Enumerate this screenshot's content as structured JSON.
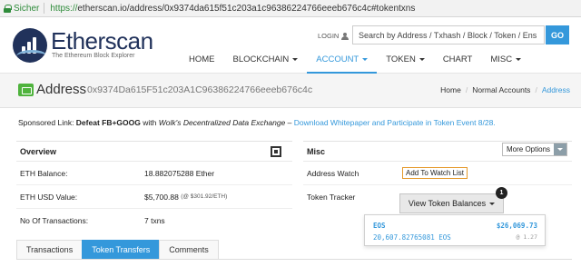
{
  "browser": {
    "secure_label": "Sicher",
    "scheme": "https://",
    "url_rest": "etherscan.io/address/0x9374da615f51c203a1c96386224766eeeb676c4c#tokentxns"
  },
  "header": {
    "brand": "Etherscan",
    "tagline": "The Ethereum Block Explorer",
    "login": "LOGIN",
    "search_placeholder": "Search by Address / Txhash / Block / Token / Ens",
    "go": "GO",
    "nav": [
      {
        "label": "HOME"
      },
      {
        "label": "BLOCKCHAIN"
      },
      {
        "label": "ACCOUNT"
      },
      {
        "label": "TOKEN"
      },
      {
        "label": "CHART"
      },
      {
        "label": "MISC"
      }
    ]
  },
  "titlebar": {
    "title": "Address",
    "address": "0x9374Da615F51c203A1C96386224766eeeb676c4c",
    "breadcrumb": [
      "Home",
      "Normal Accounts",
      "Address"
    ]
  },
  "sponsor": {
    "lead": "Sponsored Link: ",
    "bold": "Defeat FB+GOOG",
    "with": " with ",
    "italic": "Wolk's Decentralized Data Exchange",
    "dash": " – ",
    "link": "Download Whitepaper and Participate in Token Event 8/28."
  },
  "overview": {
    "heading": "Overview",
    "rows": [
      {
        "label": "ETH Balance:",
        "value": "18.882075288 Ether",
        "extra": ""
      },
      {
        "label": "ETH USD Value:",
        "value": "$5,700.88",
        "extra": "(@ $301.92/ETH)"
      },
      {
        "label": "No Of Transactions:",
        "value": "7 txns",
        "extra": ""
      }
    ]
  },
  "misc": {
    "heading": "Misc",
    "more_options": "More Options",
    "address_watch_label": "Address Watch",
    "watch_button": "Add To Watch List",
    "token_tracker_label": "Token Tracker",
    "token_button": "View Token Balances",
    "badge": "1"
  },
  "token_dropdown": {
    "name": "EOS",
    "usd_value": "$26,069.73",
    "quantity": "20,607.82765081 EOS",
    "price": "@ 1.27"
  },
  "tabs": [
    {
      "label": "Transactions",
      "active": false
    },
    {
      "label": "Token Transfers",
      "active": true
    },
    {
      "label": "Comments",
      "active": false
    }
  ],
  "colors": {
    "accent": "#3498db",
    "brand_navy": "#21325b",
    "secure_green": "#2e8b3a",
    "watch_orange": "#e59a2c"
  }
}
